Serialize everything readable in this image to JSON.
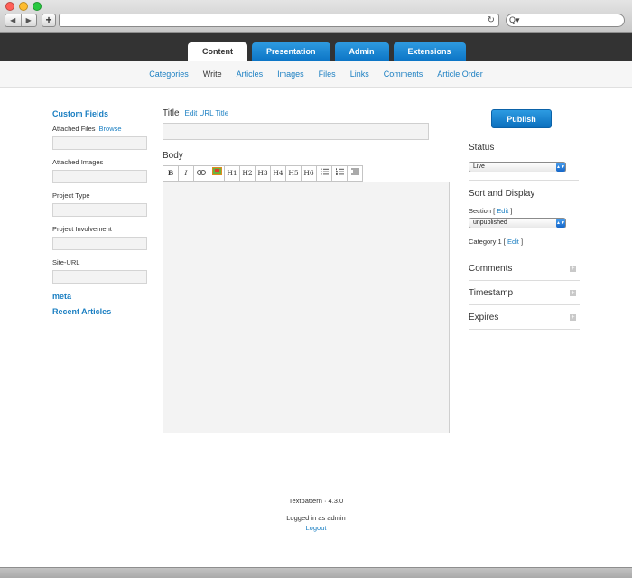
{
  "browser": {
    "back_icon": "back-arrow-icon",
    "forward_icon": "forward-arrow-icon",
    "new_tab": "+",
    "reload_glyph": "↻",
    "search_glyph": "Q▾",
    "colors": {
      "close": "#ff5f57",
      "minimize": "#febc2e",
      "zoom": "#28c840"
    }
  },
  "app": {
    "main_tabs": [
      {
        "label": "Content",
        "active": true
      },
      {
        "label": "Presentation",
        "active": false
      },
      {
        "label": "Admin",
        "active": false
      },
      {
        "label": "Extensions",
        "active": false
      }
    ],
    "sub_tabs": [
      {
        "label": "Categories",
        "active": false
      },
      {
        "label": "Write",
        "active": true
      },
      {
        "label": "Articles",
        "active": false
      },
      {
        "label": "Images",
        "active": false
      },
      {
        "label": "Files",
        "active": false
      },
      {
        "label": "Links",
        "active": false
      },
      {
        "label": "Comments",
        "active": false
      },
      {
        "label": "Article Order",
        "active": false
      }
    ],
    "accent": "#1b7fc2"
  },
  "left": {
    "custom_fields_heading": "Custom Fields",
    "attached_files_label": "Attached Files",
    "browse_link": "Browse",
    "attached_images_label": "Attached Images",
    "project_type_label": "Project Type",
    "project_involvement_label": "Project Involvement",
    "site_url_label": "Site-URL",
    "meta_link": "meta",
    "recent_articles_link": "Recent Articles"
  },
  "editor": {
    "title_label": "Title",
    "edit_url_title_link": "Edit URL Title",
    "title_value": "",
    "body_label": "Body",
    "body_value": "",
    "toolbar": [
      "B",
      "I",
      "link-icon",
      "image-icon",
      "H1",
      "H2",
      "H3",
      "H4",
      "H5",
      "H6",
      "bullet-list-icon",
      "numbered-list-icon",
      "blockquote-icon"
    ]
  },
  "right": {
    "publish_label": "Publish",
    "status_heading": "Status",
    "status_value": "Live",
    "sort_heading": "Sort and Display",
    "section_label": "Section [",
    "section_edit": "Edit",
    "section_close": "]",
    "section_value": "unpublished",
    "category_label": "Category 1 [",
    "category_edit": "Edit",
    "category_close": "]",
    "comments_label": "Comments",
    "timestamp_label": "Timestamp",
    "expires_label": "Expires",
    "expand_glyph": "+"
  },
  "footer": {
    "version": "Textpattern · 4.3.0",
    "logged_in": "Logged in as admin",
    "logout": "Logout"
  }
}
